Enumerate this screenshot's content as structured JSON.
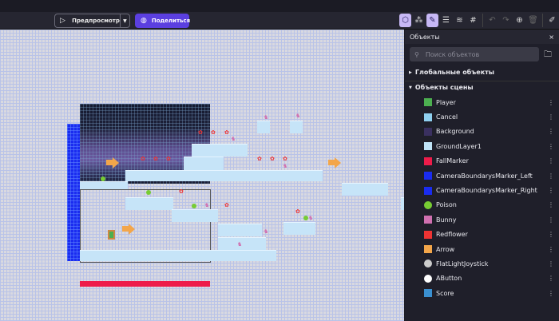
{
  "toolbar": {
    "preview_label": "Предпросмотр",
    "share_label": "Поделиться",
    "icons": [
      "object-icon",
      "object-groups-icon",
      "edit-properties-icon",
      "instances-list-icon",
      "layers-icon",
      "grid-icon",
      "undo-icon",
      "redo-icon",
      "zoom-icon",
      "delete-icon",
      "edit-scene-icon"
    ]
  },
  "panel": {
    "title": "Объекты",
    "close": "×",
    "search_placeholder": "Поиск объектов",
    "global_group": "Глобальные объекты",
    "scene_group": "Объекты сцены",
    "items": [
      {
        "label": "Player",
        "color": "#4caf50"
      },
      {
        "label": "Cancel",
        "color": "#8fd0f0"
      },
      {
        "label": "Background",
        "color": "#3a3060"
      },
      {
        "label": "GroundLayer1",
        "color": "#bfe3f7"
      },
      {
        "label": "FallMarker",
        "color": "#ee1c4a"
      },
      {
        "label": "CameraBoundarysMarker_Left",
        "color": "#1a2cf0"
      },
      {
        "label": "CameraBoundarysMarker_Right",
        "color": "#1a2cf0"
      },
      {
        "label": "Poison",
        "color": "#7c3"
      },
      {
        "label": "Bunny",
        "color": "#d070b0"
      },
      {
        "label": "Redflower",
        "color": "#e33"
      },
      {
        "label": "Arrow",
        "color": "#f3a64a"
      },
      {
        "label": "FlatLightJoystick",
        "color": "#ccc"
      },
      {
        "label": "AButton",
        "color": "#fff"
      },
      {
        "label": "Score",
        "color": "#3a8fd0"
      }
    ]
  }
}
